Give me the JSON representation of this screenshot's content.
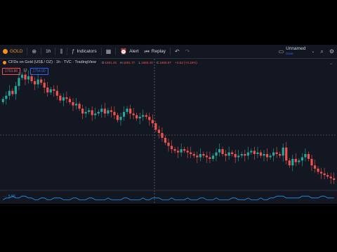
{
  "toolbar": {
    "symbol": "GOLD",
    "timeframe": "1h",
    "indicators": "Indicators",
    "alert": "Alert",
    "replay": "Replay",
    "layout_name": "Unnamed",
    "layout_sub": "Save"
  },
  "legend": {
    "title": "CFDs on Gold (US$ / OZ) · 1h · TVC · TradingView",
    "ohlc": [
      {
        "key": "O",
        "value": "1691.45"
      },
      {
        "key": "H",
        "value": "1691.77"
      },
      {
        "key": "L",
        "value": "1686.40"
      },
      {
        "key": "C",
        "value": "1688.97"
      },
      {
        "key": "",
        "value": "+2.62 (+0.15%)"
      }
    ],
    "sell_price": "1753.88",
    "spread": "12",
    "buy_price": "1754.00"
  },
  "indicator": {
    "value": "5.56"
  },
  "colors": {
    "up": "#26a69a",
    "down": "#ef5350",
    "indicator": "#2196f3",
    "background": "#131722"
  },
  "chart_data": {
    "type": "candlestick",
    "note": "approximate hourly OHLC sequence read from screen (relative price units)",
    "series": [
      {
        "name": "price",
        "close": [
          1739,
          1741,
          1744,
          1742,
          1747,
          1752,
          1754,
          1751,
          1753,
          1750,
          1748,
          1751,
          1749,
          1746,
          1743,
          1745,
          1744,
          1741,
          1738,
          1740,
          1739,
          1737,
          1735,
          1736,
          1733,
          1730,
          1731,
          1732,
          1729,
          1730,
          1731,
          1733,
          1730,
          1732,
          1731,
          1729,
          1726,
          1728,
          1731,
          1733,
          1730,
          1729,
          1727,
          1728,
          1729,
          1728,
          1726,
          1724,
          1720,
          1718,
          1715,
          1712,
          1710,
          1708,
          1707,
          1706,
          1708,
          1707,
          1706,
          1705,
          1704,
          1703,
          1705,
          1704,
          1703,
          1702,
          1704,
          1706,
          1708,
          1705,
          1704,
          1706,
          1705,
          1703,
          1704,
          1705,
          1704,
          1706,
          1707,
          1705,
          1706,
          1704,
          1705,
          1703,
          1704,
          1706,
          1705,
          1704,
          1709,
          1701,
          1698,
          1702,
          1700,
          1701,
          1703,
          1705,
          1702,
          1698,
          1696,
          1694,
          1693,
          1692,
          1691,
          1690,
          1689
        ]
      }
    ],
    "indicator_series": [
      {
        "name": "volume-oscillator",
        "values": [
          4,
          5,
          5,
          6,
          5,
          5,
          6,
          6,
          5,
          5,
          4,
          4,
          5,
          5,
          4,
          4,
          5,
          5,
          5,
          4,
          4,
          4,
          5,
          5,
          4,
          4,
          4,
          5,
          5,
          4,
          4,
          4,
          4,
          5,
          4,
          4,
          4,
          4,
          5,
          5,
          4,
          4,
          4,
          4,
          5,
          4,
          4,
          5,
          5,
          5,
          4,
          4,
          4,
          5,
          4,
          4,
          4,
          4,
          5,
          4,
          4,
          4,
          5,
          5,
          4,
          4,
          4,
          5,
          4,
          4,
          4,
          4,
          5,
          5,
          4,
          4,
          4,
          5,
          4,
          4,
          4,
          5,
          4,
          4,
          5,
          5,
          6,
          6,
          6,
          5,
          5,
          5,
          5,
          5,
          6,
          6,
          6,
          5,
          5,
          5,
          6,
          6,
          5,
          5,
          5
        ]
      }
    ]
  }
}
